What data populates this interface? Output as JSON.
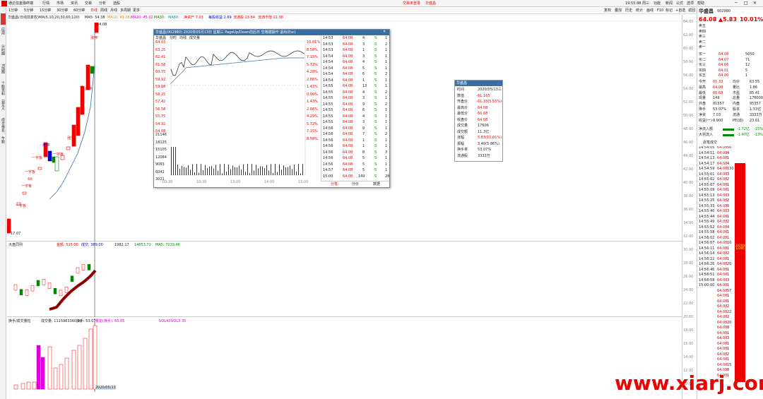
{
  "menubar": {
    "app_title": "通达信金融终端",
    "menus": [
      "行情",
      "市场",
      "资讯",
      "交易",
      "分析",
      "选股"
    ],
    "center_labels": [
      "交易未登录",
      "华盛昌"
    ],
    "clock": "19:55:48 周三",
    "right_menus": [
      "功能",
      "新闻",
      "公式",
      "选项",
      "帮助"
    ]
  },
  "toolbar": {
    "periods": [
      "1分钟",
      "5分钟",
      "15分钟",
      "30分钟",
      "60分钟",
      "日线",
      "周线",
      "月线",
      "多周期",
      "更多"
    ],
    "active_period": "日线",
    "indicators": [
      "MA5",
      "MA10",
      "MA20",
      "MA60"
    ],
    "right_buttons": [
      "复权",
      "叠加",
      "历史",
      "统计",
      "画线",
      "F10",
      "标记",
      "+自选",
      "返回"
    ]
  },
  "titlebar": {
    "prefix": "华盛昌(日线前复权)",
    "ma_label": "MA(5,10,20,30,60,120)",
    "ma5": "MA5: 54.38",
    "ma10": "MA10: 49.08",
    "ma20": "MA20: 45.02",
    "ma30": "MA30: ",
    "ma60": "MA60: ",
    "extra1": "净资产 7.03",
    "extra2": "每股收益 2.69",
    "extra3": "流通股 23.84",
    "extra4": "流通市值 21.38"
  },
  "leftnav": [
    "应用",
    "分时图",
    "K线图",
    "个股资料",
    "自定义",
    "综合排名",
    "牛股",
    "选股器",
    "热点"
  ],
  "chart": {
    "top_price": "64.08",
    "low_price": "17.07",
    "labels": [
      "涨停",
      "涨停",
      "一字板",
      "一字板",
      "一字板",
      "一字板",
      "一字板",
      "涨停",
      "涨停",
      "涨停"
    ],
    "date_label": "2020/05/13",
    "axis": [
      "64.00",
      "60.00",
      "56.00",
      "52.00",
      "48.00",
      "44.00",
      "40.00",
      "36.00",
      "32.00",
      "28.00",
      "24.00",
      "20.00",
      "16.00"
    ]
  },
  "sub1": {
    "title": "大盘同列",
    "values": [
      "金额: 515.00",
      "成交: 389.00",
      "1982.17",
      "14653.71",
      "MA5: 7239.46"
    ],
    "axis": [
      "7300",
      "7200",
      "7100",
      "7000",
      "6900",
      "6800"
    ]
  },
  "sub2": {
    "title": "换手/成交量柱",
    "values": [
      "成交量: 1115983360.00",
      "换手: 53.07",
      "量能(换手): 65.05",
      "VOL40",
      "VOL3 35"
    ],
    "axis": [
      "10000",
      "9000",
      "8000",
      "7000",
      "6000",
      "5000",
      "4000",
      "3000",
      "2000",
      "1000"
    ]
  },
  "popup": {
    "title": "华盛昌(002980)  2020年05月13日 星期三 PageUp/Down前后日 空格键操作 退出(Esc)",
    "tabs": [
      "华盛昌",
      "分时",
      "均线",
      "成交量"
    ],
    "price_axis": [
      "64.03",
      "63.25",
      "62.41",
      "61.58",
      "60.75",
      "59.92",
      "59.08",
      "58.25",
      "57.42",
      "56.58",
      "55.75",
      "54.92",
      "54.08"
    ],
    "pct_axis": [
      "10.01%",
      "8.58%",
      "7.15%",
      "5.72%",
      "4.28%",
      "2.86%",
      "1.43%",
      "0.00%",
      "1.43%",
      "2.86%",
      "4.29%",
      "5.72%",
      "7.15%",
      "8.58%"
    ],
    "vol_axis": [
      "21146",
      "18125",
      "15105",
      "12084",
      "9063",
      "6042",
      "3021"
    ],
    "time_axis": [
      "09:30",
      "10:30",
      "13:00",
      "14:00",
      "15:00"
    ],
    "trades": [
      [
        "14:53",
        "64.08",
        "4",
        "S",
        "1"
      ],
      [
        "14:53",
        "64.08",
        "3",
        "S",
        "2"
      ],
      [
        "14:53",
        "64.08",
        "1",
        "S",
        "1"
      ],
      [
        "14:54",
        "64.08",
        "3",
        "S",
        "1"
      ],
      [
        "14:54",
        "64.08",
        "4",
        "S",
        "1"
      ],
      [
        "14:54",
        "64.08",
        "5",
        "S",
        "1"
      ],
      [
        "14:54",
        "64.08",
        "6",
        "S",
        "2"
      ],
      [
        "14:54",
        "64.08",
        "1",
        "S",
        "1"
      ],
      [
        "14:55",
        "64.08",
        "13",
        "S",
        "1"
      ],
      [
        "14:55",
        "64.08",
        "4",
        "S",
        "2"
      ],
      [
        "14:55",
        "64.08",
        "3",
        "S",
        "1"
      ],
      [
        "14:55",
        "64.08",
        "9",
        "S",
        "2"
      ],
      [
        "14:55",
        "64.08",
        "6",
        "S",
        "1"
      ],
      [
        "14:55",
        "64.08",
        "4",
        "S",
        "1"
      ],
      [
        "14:55",
        "64.08",
        "3",
        "S",
        "1"
      ],
      [
        "14:56",
        "64.08",
        "9",
        "S",
        "1"
      ],
      [
        "14:56",
        "64.08",
        "7",
        "S",
        "2"
      ],
      [
        "14:56",
        "64.08",
        "1",
        "S",
        "1"
      ],
      [
        "14:56",
        "64.08",
        "1",
        "S",
        "1"
      ],
      [
        "14:56",
        "64.08",
        "8",
        "S",
        "3"
      ],
      [
        "14:56",
        "64.08",
        "5",
        "S",
        "1"
      ],
      [
        "14:56",
        "64.08",
        "5",
        "S",
        "1"
      ],
      [
        "14:57",
        "64.08",
        "5",
        "S",
        "1"
      ],
      [
        "15:00",
        "64.08",
        "149",
        "S",
        "28"
      ]
    ],
    "footer_tabs": [
      "分笔",
      "分价",
      "数据"
    ]
  },
  "mini": {
    "title": "华盛昌",
    "rows": [
      [
        "时间",
        "2020/05/13三"
      ],
      [
        "数值",
        "61.165"
      ],
      [
        "开盘价",
        "61.33(5.55%)"
      ],
      [
        "最高价",
        "64.08"
      ],
      [
        "最低价",
        "60.68"
      ],
      [
        "收盘价",
        "64.08"
      ],
      [
        "成交量",
        "17606"
      ],
      [
        "成交额",
        "11.3亿"
      ],
      [
        "涨幅",
        "5.83(10.01%)"
      ],
      [
        "振幅",
        "3.40(5.86%)"
      ],
      [
        "换手率",
        "53.07%"
      ],
      [
        "流通股",
        "3333万"
      ]
    ]
  },
  "rpanel": {
    "name": "华盛昌",
    "code": "002980",
    "price": "64.08",
    "change": "▲5.83",
    "pct": "10.01%",
    "sells": [
      [
        "卖五",
        "",
        ""
      ],
      [
        "卖四",
        "",
        ""
      ],
      [
        "卖三",
        "",
        ""
      ],
      [
        "卖二",
        "",
        ""
      ],
      [
        "卖一",
        "",
        ""
      ]
    ],
    "buys": [
      [
        "买一",
        "64.08",
        "5050"
      ],
      [
        "买二",
        "64.07",
        "71"
      ],
      [
        "买三",
        "64.06",
        "12"
      ],
      [
        "买四",
        "64.01",
        "5"
      ],
      [
        "买五",
        "64.00",
        "1"
      ]
    ],
    "stats": [
      [
        "今开",
        "61.33",
        "均价",
        "63.55"
      ],
      [
        "最高",
        "64.08",
        "量比",
        "1.86"
      ],
      [
        "最低",
        "60.68",
        "市盈",
        "85.41"
      ],
      [
        "现量",
        "149",
        "总量",
        "176000"
      ],
      [
        "外盘",
        "81557",
        "内盘",
        "95357"
      ],
      [
        "换手",
        "53.07%",
        "股本",
        "1.33亿"
      ],
      [
        "净资",
        "7.03",
        "流通",
        "3333万"
      ],
      [
        "收益(一)",
        "0.900",
        "PE(动)",
        "23.61"
      ]
    ],
    "flows": [
      [
        "净流入额",
        "-1.72亿",
        "-15%"
      ],
      [
        "大宗流入",
        "-1.47亿",
        "-13%"
      ]
    ],
    "ticks_title": "逐笔成交",
    "ticks": [
      [
        "14:54:05",
        "64.08",
        "50"
      ],
      [
        "14:54:11",
        "64.08",
        "4"
      ],
      [
        "14:54:13",
        "64.08",
        "1"
      ],
      [
        "14:54:17",
        "64.08",
        "4"
      ],
      [
        "14:54:59",
        "64.08",
        "130"
      ],
      [
        "14:55:01",
        "64.08",
        "3"
      ],
      [
        "14:55:02",
        "64.08",
        "2"
      ],
      [
        "14:55:07",
        "64.08",
        "1"
      ],
      [
        "14:55:09",
        "64.08",
        "1"
      ],
      [
        "14:55:13",
        "64.08",
        "3"
      ],
      [
        "14:55:25",
        "64.08",
        "2"
      ],
      [
        "14:55:33",
        "64.08",
        "6"
      ],
      [
        "14:55:40",
        "64.08",
        "3"
      ],
      [
        "14:55:44",
        "64.08",
        "1"
      ],
      [
        "14:55:49",
        "64.08",
        "2"
      ],
      [
        "14:55:52",
        "64.08",
        "4"
      ],
      [
        "14:55:58",
        "64.08",
        "1"
      ],
      [
        "14:56:02",
        "64.08",
        "1"
      ],
      [
        "14:56:07",
        "64.08",
        "10"
      ],
      [
        "14:56:11",
        "64.08",
        "1"
      ],
      [
        "14:56:14",
        "64.08",
        "2"
      ],
      [
        "14:56:22",
        "64.08",
        "1"
      ],
      [
        "14:56:26",
        "64.08",
        "20"
      ],
      [
        "14:56:46",
        "64.08",
        "1"
      ],
      [
        "14:56:51",
        "64.08",
        "1"
      ],
      [
        "14:56:58",
        "64.08",
        "3"
      ],
      [
        "15:00:00",
        "64.08",
        "1"
      ],
      [
        "",
        "64.08",
        "57"
      ],
      [
        "",
        "64.08",
        "1"
      ],
      [
        "",
        "64.08",
        "1"
      ],
      [
        "",
        "64.08",
        "2"
      ],
      [
        "",
        "64.08",
        "22"
      ],
      [
        "",
        "64.08",
        "2"
      ],
      [
        "",
        "64.08",
        "20"
      ],
      [
        "",
        "64.08",
        "8"
      ],
      [
        "",
        "64.08",
        "1"
      ],
      [
        "",
        "64.08",
        "3"
      ],
      [
        "",
        "64.08",
        "1"
      ],
      [
        "",
        "64.08",
        "1"
      ],
      [
        "",
        "64.08",
        "2"
      ],
      [
        "",
        "64.08",
        "1"
      ],
      [
        "",
        "64.08",
        "15"
      ],
      [
        "",
        "64.08",
        "8"
      ],
      [
        "",
        "64.08",
        "1"
      ]
    ],
    "bar_label": "2020年\n12395"
  },
  "right_axis": [
    "64.00",
    "62.00",
    "60.00",
    "58.00",
    "56.00",
    "54.00",
    "52.00",
    "50.00",
    "48.00",
    "46.00",
    "44.00",
    "42.00",
    "40.00",
    "38.00",
    "36.00",
    "34.00",
    "32.00",
    "30.00",
    "28.00",
    "26.00",
    "24.00",
    "22.00",
    "20.00",
    "18.00",
    "16.00",
    "14.00",
    "12.00",
    "10.00"
  ],
  "watermark": "www.xiarj.com"
}
